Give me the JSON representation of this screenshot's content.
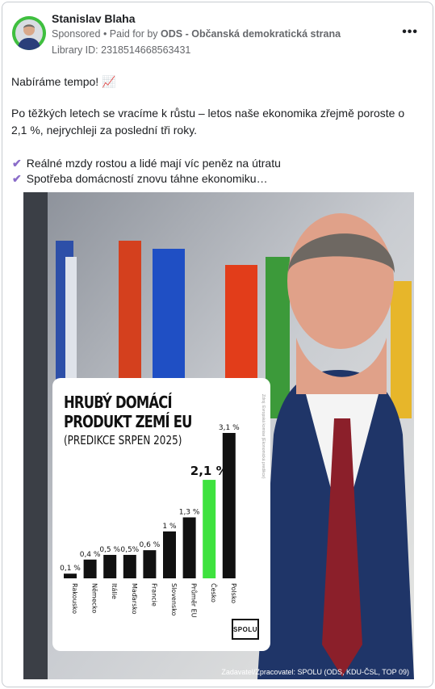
{
  "post": {
    "author": "Stanislav Blaha",
    "sponsored": "Sponsored",
    "paid_for_prefix": "• Paid for by",
    "payer": "ODS - Občanská demokratická strana",
    "library_id": "Library ID: 2318514668563431",
    "more_icon": "more-horizontal-icon",
    "text_line1": "Nabíráme tempo! 📈",
    "text_para2": "Po těžkých letech se vracíme k růstu – letos naše ekonomika zřejmě poroste o 2,1 %, nejrychleji za poslední tři roky.",
    "checks": [
      "Reálné mzdy rostou a lidé mají víc peněz na útratu",
      "Spotřeba domácností znovu táhne ekonomiku…"
    ],
    "check_glyph": "✔"
  },
  "image": {
    "title_line1": "HRUBÝ DOMÁCÍ",
    "title_line2": "PRODUKT ZEMÍ EU",
    "subtitle": "(PREDIKCE SRPEN 2025)",
    "side_note": "Zdroj: Evropská komise (Ekonomická predikce)",
    "logo_text": "SPOLU",
    "credit": "Zadavatel/Zpracovatel: SPOLU (ODS, KDU-ČSL, TOP 09)",
    "highlight_color": "#3ee23e",
    "bar_color": "#111111"
  },
  "chart_data": {
    "type": "bar",
    "categories": [
      "Rakousko",
      "Německo",
      "Itálie",
      "Maďarsko",
      "Francie",
      "Slovensko",
      "Průměr EU",
      "Česko",
      "Polsko"
    ],
    "values": [
      0.1,
      0.4,
      0.5,
      0.5,
      0.6,
      1.0,
      1.3,
      2.1,
      3.1
    ],
    "labels": [
      "0,1 %",
      "0,4 %",
      "0,5 %",
      "0,5%",
      "0,6 %",
      "1 %",
      "1,3 %",
      "2,1 %",
      "3,1 %"
    ],
    "highlight_index": 7,
    "title": "HRUBÝ DOMÁCÍ PRODUKT ZEMÍ EU",
    "subtitle": "(PREDIKCE SRPEN 2025)",
    "xlabel": "",
    "ylabel": ""
  }
}
